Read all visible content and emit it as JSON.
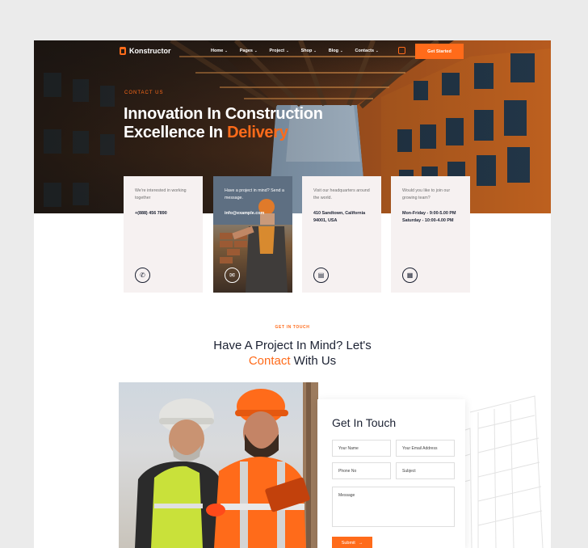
{
  "nav": {
    "brand": "Konstructor",
    "items": [
      {
        "label": "Home"
      },
      {
        "label": "Pages"
      },
      {
        "label": "Project"
      },
      {
        "label": "Shop"
      },
      {
        "label": "Blog"
      },
      {
        "label": "Contacts"
      }
    ],
    "cta": "Get Started",
    "chevron_icon": "chevron-down-icon",
    "cart_icon": "shopping-bag-icon"
  },
  "hero": {
    "kicker": "CONTACT US",
    "title_line1": "Innovation In Construction",
    "title_line2_a": "Excellence In ",
    "title_line2_b": "Delivery"
  },
  "cards": [
    {
      "text": "We're interested in working together",
      "value": "+(888) 456 7890",
      "icon": "phone-icon"
    },
    {
      "text": "Have a project in mind? Send a message.",
      "value": "info@example.com",
      "icon": "mail-icon"
    },
    {
      "text": "Visit our headquarters around the world.",
      "value": "410 Sandtown, California 94001, USA",
      "icon": "building-icon"
    },
    {
      "text": "Would you like to join our growing team?",
      "value_line1": "Mon-Friday - 9:00-5.00 PM",
      "value_line2": "Saturday - 10:00-4.00 PM",
      "icon": "calendar-icon"
    }
  ],
  "section": {
    "kicker": "GET IN TOUCH",
    "title_line1": "Have A Project In Mind? Let's",
    "title_line2_a": "Contact",
    "title_line2_b": " With Us"
  },
  "form": {
    "title": "Get In Touch",
    "name_placeholder": "Your Name",
    "email_placeholder": "Your Email Address",
    "phone_placeholder": "Phone No",
    "subject_placeholder": "Subject",
    "message_placeholder": "Message",
    "submit": "Submit",
    "submit_arrow": "→"
  },
  "colors": {
    "accent": "#ff6b1a",
    "dark": "#1b2132",
    "card_bg": "#f6f1f1",
    "page_bg": "#ebebeb"
  }
}
